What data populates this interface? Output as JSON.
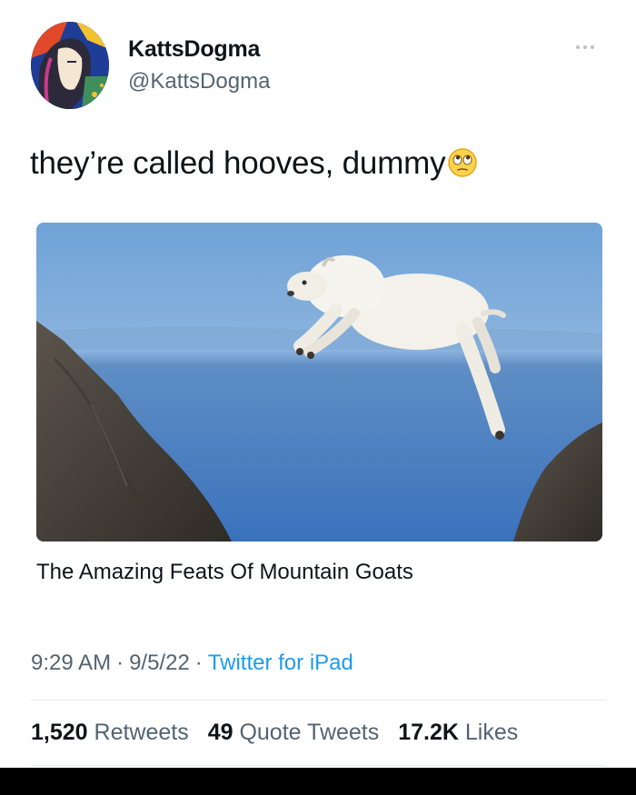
{
  "author": {
    "name": "KattsDogma",
    "handle": "@KattsDogma",
    "avatar_icon": "portrait-avatar-icon"
  },
  "tweet": {
    "text": "they’re called hooves, dummy",
    "emoji_icon": "face-with-rolling-eyes-icon"
  },
  "media": {
    "description_icon": "mountain-goat-leaping-photo",
    "link_title": "The Amazing Feats Of Mountain Goats"
  },
  "meta": {
    "time": "9:29 AM",
    "separator": "·",
    "date": "9/5/22",
    "source": "Twitter for iPad"
  },
  "stats": {
    "retweets_count": "1,520",
    "retweets_label": "Retweets",
    "quotes_count": "49",
    "quotes_label": "Quote Tweets",
    "likes_count": "17.2K",
    "likes_label": "Likes"
  },
  "colors": {
    "link_blue": "#1d9bf0",
    "secondary_text": "#536471",
    "primary_text": "#0f1419"
  }
}
